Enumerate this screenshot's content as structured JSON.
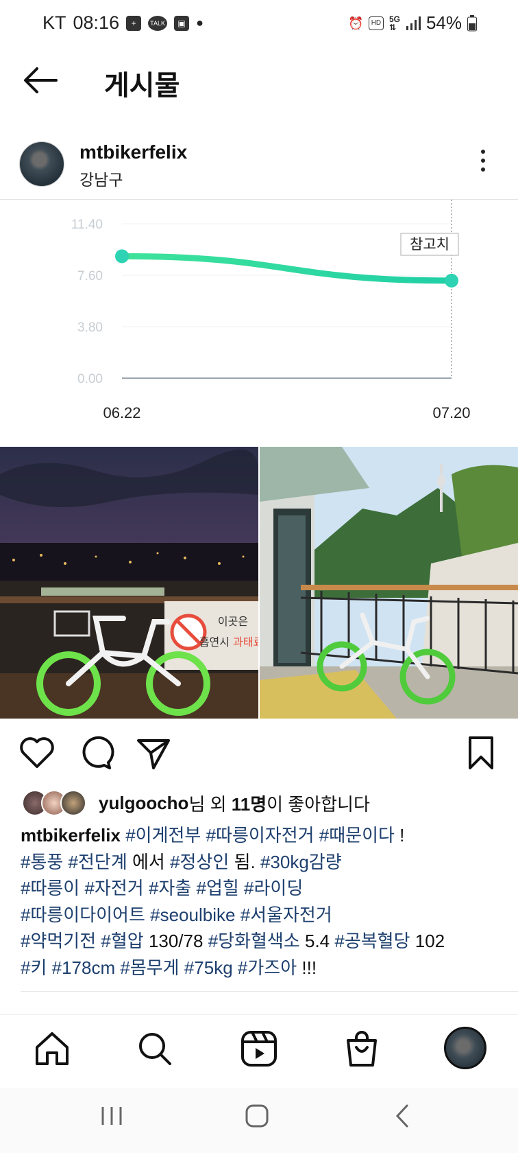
{
  "status_bar": {
    "carrier": "KT",
    "time": "08:16",
    "battery": "54%",
    "icons_left": [
      "plus-icon",
      "talk-icon",
      "image-icon",
      "dot-icon"
    ],
    "icons_right": [
      "alarm-icon",
      "hd-icon",
      "5g-icon",
      "signal-icon",
      "battery-icon"
    ]
  },
  "header": {
    "title": "게시물"
  },
  "post": {
    "username": "mtbikerfelix",
    "location": "강남구"
  },
  "chart_data": {
    "type": "line",
    "x": [
      "06.22",
      "07.20"
    ],
    "series": [
      {
        "values": [
          9.0,
          7.2
        ]
      }
    ],
    "y_ticks": [
      "11.40",
      "7.60",
      "3.80",
      "0.00"
    ],
    "ylim": [
      0,
      11.4
    ],
    "annotation": "참고치",
    "grid": true,
    "colors": {
      "line_start": "#3ee39a",
      "line_end": "#21cfa6",
      "point": "#2dd3b3"
    }
  },
  "likes": {
    "user": "yulgoocho",
    "suffix_1": "님 외 ",
    "count": "11명",
    "suffix_2": "이 좋아합니다"
  },
  "caption": {
    "username": "mtbikerfelix",
    "line1": [
      "#이게전부",
      "#따릉이자전거",
      "#때문이다"
    ],
    "line1_tail": "!",
    "line2_tags1": [
      "#통풍",
      "#전단계"
    ],
    "line2_text": "에서",
    "line2_tags2": [
      "#정상인"
    ],
    "line2_text2": "됨.",
    "line2_tags3": [
      "#30kg감량"
    ],
    "line3": [
      "#따릉이",
      "#자전거",
      "#자출",
      "#업힐",
      "#라이딩"
    ],
    "line4": [
      "#따릉이다이어트",
      "#seoulbike",
      "#서울자전거"
    ],
    "line5_a": [
      "#약먹기전",
      "#혈압"
    ],
    "line5_v1": "130/78",
    "line5_b": [
      "#당화혈색소"
    ],
    "line5_v2": "5.4",
    "line5_c": [
      "#공복혈당"
    ],
    "line5_v3": "102",
    "line6_a": [
      "#키",
      "#178cm",
      "#몸무게",
      "#75kg",
      "#가즈아"
    ],
    "line6_tail": "!!!"
  },
  "photos": {
    "left_sign_line1": "이곳은",
    "left_sign_line2": "흡연시",
    "left_sign_red": "과태료"
  },
  "colors": {
    "hashtag": "#1d3f6e",
    "accent": "#2dd3b3"
  }
}
